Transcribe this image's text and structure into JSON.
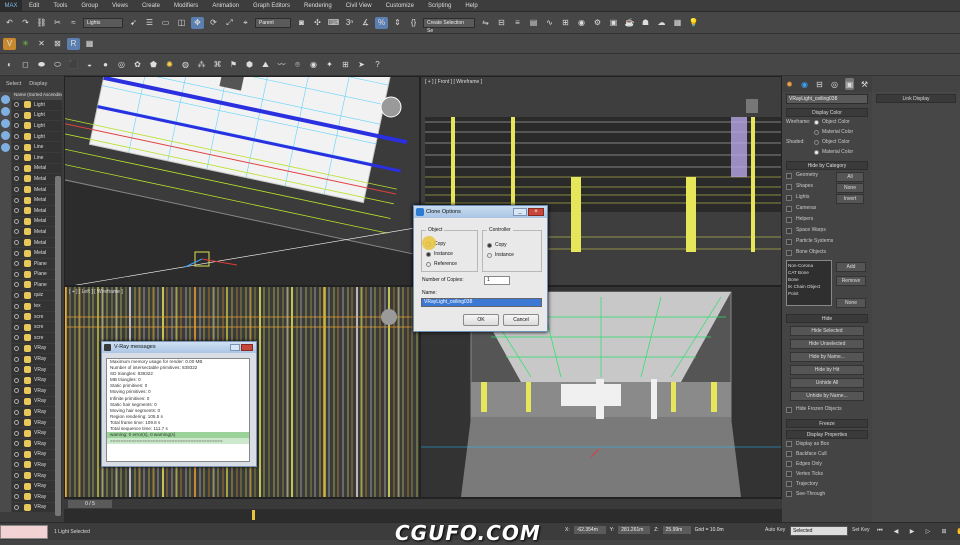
{
  "menu": {
    "logo": "MAX",
    "items": [
      "Edit",
      "Tools",
      "Group",
      "Views",
      "Create",
      "Modifiers",
      "Animation",
      "Graph Editors",
      "Rendering",
      "Civil View",
      "Customize",
      "Scripting",
      "Help"
    ]
  },
  "toolbar": {
    "filter_select": "Lights",
    "ref_coord_select": "Parent",
    "named_selection": "Create Selection Se"
  },
  "scene_explorer": {
    "tab_select": "Select",
    "tab_display": "Display",
    "header": "Name (Sorted Ascending)",
    "items": [
      "Light",
      "Light",
      "Light",
      "Light",
      "Line",
      "Line",
      "Metal",
      "Metal",
      "Metal",
      "Metal",
      "Metal",
      "Metal",
      "Metal",
      "Metal",
      "Metal",
      "Plane",
      "Plane",
      "Plane",
      "quiz",
      "tex",
      "scre",
      "scre",
      "scre",
      "VRay",
      "VRay",
      "VRay",
      "VRay",
      "VRay",
      "VRay",
      "VRay",
      "VRay",
      "VRay",
      "VRay",
      "VRay",
      "VRay",
      "VRay",
      "VRay",
      "VRay",
      "VRay",
      "VRay",
      "VRay",
      "VRay",
      "VRay",
      "VRay"
    ]
  },
  "viewports": {
    "front_label": "[ + ] [ Front ] [ Wireframe ]",
    "left_label": "[ + ] [ Left ] [ Wireframe ]"
  },
  "clone_dialog": {
    "title": "Clone Options",
    "object_group": "Object",
    "controller_group": "Controller",
    "copy": "Copy",
    "instance": "Instance",
    "reference": "Reference",
    "ctrl_copy": "Copy",
    "ctrl_instance": "Instance",
    "num_copies_label": "Number of Copies:",
    "num_copies": "1",
    "name_label": "Name:",
    "name_value": "VRayLight_ceiling038",
    "ok": "OK",
    "cancel": "Cancel"
  },
  "vray_messages": {
    "title": "V-Ray messages",
    "lines": [
      "Maximum memory usage for render: 0.00 MB",
      "Number of intersectable primitives: 839322",
      "SD triangles: 839322",
      "MB triangles: 0",
      "Static primitives: 0",
      "Moving primitives: 0",
      "Infinite primitives: 0",
      "Static hair segments: 0",
      "Moving hair segments: 0",
      "Region rendering: 105.5 s",
      "Total frame time: 109.8 s",
      "Total sequence time: 111.7 s",
      "warning: 0 error(s), 0 warning(s)",
      "=========================================="
    ]
  },
  "display_panel": {
    "object_name": "VRayLight_ceiling038",
    "display_color_head": "Display Color",
    "wireframe_label": "Wireframe:",
    "shaded_label": "Shaded:",
    "object_color": "Object Color",
    "material_color": "Material Color",
    "hide_by_category_head": "Hide by Category",
    "categories": [
      "Geometry",
      "Shapes",
      "Lights",
      "Cameras",
      "Helpers",
      "Space Warps",
      "Particle Systems",
      "Bone Objects"
    ],
    "cat_buttons": [
      "All",
      "None",
      "Invert"
    ],
    "list_items": [
      "Non-Corona",
      "CAT Bone",
      "Bone",
      "IK Chain Object",
      "Point"
    ],
    "list_buttons": [
      "Add",
      "Remove",
      "None"
    ],
    "hide_head": "Hide",
    "hide_buttons": [
      "Hide Selected",
      "Hide Unselected",
      "Hide by Name...",
      "Hide by Hit",
      "Unhide All",
      "Unhide by Name..."
    ],
    "hide_frozen": "Hide Frozen Objects",
    "freeze_head": "Freeze",
    "display_props_head": "Display Properties",
    "props": [
      "Display as Box",
      "Backface Cull",
      "Edges Only",
      "Vertex Ticks",
      "Trajectory",
      "See-Through"
    ]
  },
  "link_display": {
    "title": "Link Display"
  },
  "timeline": {
    "frame": "0 / 5"
  },
  "status": {
    "selected": "1 Light Selected",
    "x": "-62.354m",
    "y": "281.261m",
    "z": "25.99m",
    "grid": "Grid = 10.0m",
    "autokey": "Auto Key",
    "key_select": "Selected",
    "set_key": "Set Key"
  },
  "watermark": "CGUFO.COM"
}
